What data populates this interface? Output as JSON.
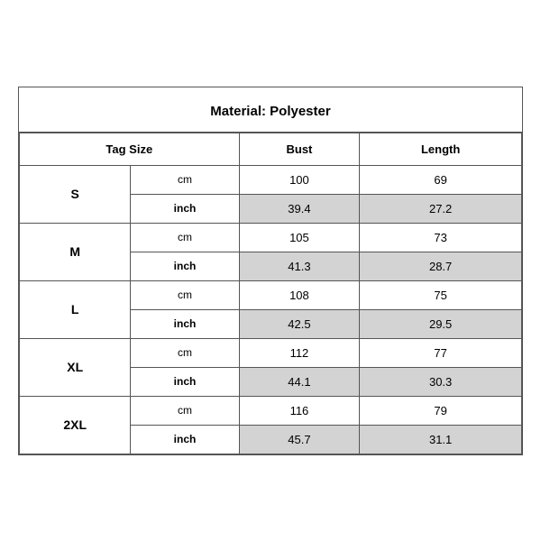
{
  "title": "Material: Polyester",
  "headers": {
    "tag_size": "Tag Size",
    "bust": "Bust",
    "length": "Length"
  },
  "sizes": [
    {
      "tag": "S",
      "cm": {
        "bust": "100",
        "length": "69"
      },
      "inch": {
        "bust": "39.4",
        "length": "27.2"
      }
    },
    {
      "tag": "M",
      "cm": {
        "bust": "105",
        "length": "73"
      },
      "inch": {
        "bust": "41.3",
        "length": "28.7"
      }
    },
    {
      "tag": "L",
      "cm": {
        "bust": "108",
        "length": "75"
      },
      "inch": {
        "bust": "42.5",
        "length": "29.5"
      }
    },
    {
      "tag": "XL",
      "cm": {
        "bust": "112",
        "length": "77"
      },
      "inch": {
        "bust": "44.1",
        "length": "30.3"
      }
    },
    {
      "tag": "2XL",
      "cm": {
        "bust": "116",
        "length": "79"
      },
      "inch": {
        "bust": "45.7",
        "length": "31.1"
      }
    }
  ],
  "units": {
    "cm": "cm",
    "inch": "inch"
  }
}
